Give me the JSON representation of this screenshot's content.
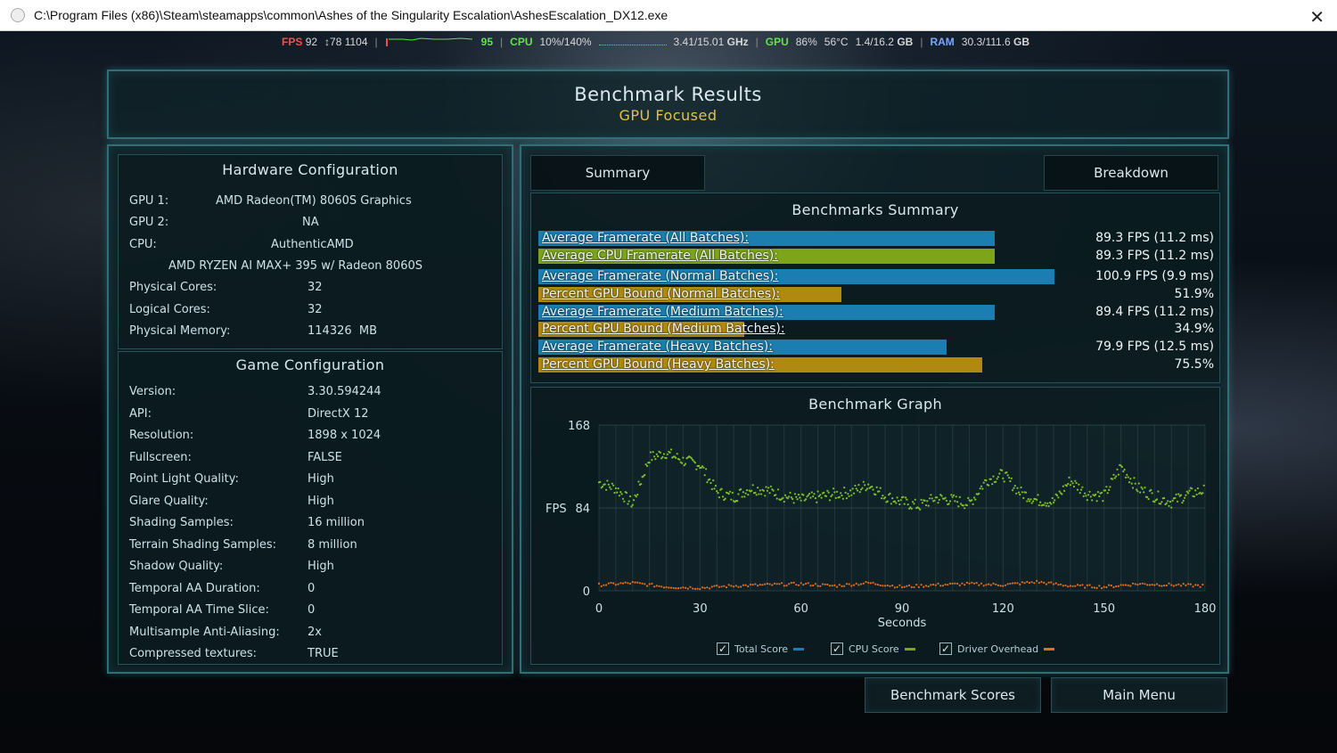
{
  "window": {
    "title": "C:\\Program Files (x86)\\Steam\\steamapps\\common\\Ashes of the Singularity Escalation\\AshesEscalation_DX12.exe",
    "close_glyph": "✕"
  },
  "overlay": {
    "fps_label": "FPS",
    "fps_value": "92",
    "frame_counts": "↕78 1104",
    "separator": "|",
    "gpu_fps_top": "95",
    "cpu_label": "CPU",
    "cpu_value": "10%/140%",
    "clock": "3.41/15.01",
    "clock_unit": "GHz",
    "gpu_label": "GPU",
    "gpu_value": "86%",
    "temp": "56°C",
    "vram": "1.4/16.2",
    "vram_unit": "GB",
    "ram_label": "RAM",
    "ram_value": "30.3/111.6",
    "ram_unit": "GB"
  },
  "header": {
    "title": "Benchmark Results",
    "subtitle": "GPU Focused"
  },
  "hardware": {
    "title": "Hardware Configuration",
    "gpu1_label": "GPU 1:",
    "gpu1_value": "AMD Radeon(TM) 8060S Graphics",
    "gpu2_label": "GPU 2:",
    "gpu2_value": "NA",
    "cpu_label": "CPU:",
    "cpu_vendor": "AuthenticAMD",
    "cpu_model": "AMD RYZEN AI MAX+ 395 w/ Radeon 8060S",
    "phys_cores_label": "Physical Cores:",
    "phys_cores_value": "32",
    "log_cores_label": "Logical Cores:",
    "log_cores_value": "32",
    "phys_mem_label": "Physical Memory:",
    "phys_mem_value": "114326  MB"
  },
  "game_config": {
    "title": "Game Configuration",
    "rows": [
      {
        "label": "Version:",
        "value": "3.30.594244"
      },
      {
        "label": "API:",
        "value": "DirectX 12"
      },
      {
        "label": "Resolution:",
        "value": "1898 x 1024"
      },
      {
        "label": "Fullscreen:",
        "value": "FALSE"
      },
      {
        "label": "Point Light Quality:",
        "value": "High"
      },
      {
        "label": "Glare Quality:",
        "value": "High"
      },
      {
        "label": "Shading Samples:",
        "value": "16 million"
      },
      {
        "label": "Terrain Shading Samples:",
        "value": "8 million"
      },
      {
        "label": "Shadow Quality:",
        "value": "High"
      },
      {
        "label": "Temporal AA Duration:",
        "value": "0"
      },
      {
        "label": "Temporal AA Time Slice:",
        "value": "0"
      },
      {
        "label": "Multisample Anti-Aliasing:",
        "value": "2x"
      },
      {
        "label": "Compressed textures:",
        "value": "TRUE"
      }
    ]
  },
  "tabs": {
    "summary": "Summary",
    "breakdown": "Breakdown"
  },
  "summary": {
    "title": "Benchmarks Summary",
    "colors": {
      "blue": "#1a7fb0",
      "green": "#7ea51a",
      "gold": "#b08a10"
    },
    "rows": [
      {
        "label": "Average Framerate (All Batches):",
        "value": "89.3 FPS (11.2 ms)",
        "fill": 0.774,
        "color": "blue"
      },
      {
        "label": "Average CPU Framerate (All Batches):",
        "value": "89.3 FPS (11.2 ms)",
        "fill": 0.774,
        "color": "green"
      },
      {
        "label": "Average Framerate (Normal Batches):",
        "value": "100.9 FPS (9.9 ms)",
        "fill": 0.874,
        "color": "blue"
      },
      {
        "label": "Percent GPU Bound (Normal Batches):",
        "value": "51.9%",
        "fill": 0.514,
        "color": "gold"
      },
      {
        "label": "Average Framerate (Medium Batches):",
        "value": "89.4 FPS (11.2 ms)",
        "fill": 0.774,
        "color": "blue"
      },
      {
        "label": "Percent GPU Bound (Medium Batches):",
        "value": "34.9%",
        "fill": 0.349,
        "color": "gold"
      },
      {
        "label": "Average Framerate (Heavy Batches):",
        "value": "79.9 FPS (12.5 ms)",
        "fill": 0.692,
        "color": "blue"
      },
      {
        "label": "Percent GPU Bound (Heavy Batches):",
        "value": "75.5%",
        "fill": 0.752,
        "color": "gold"
      }
    ]
  },
  "graph": {
    "title": "Benchmark Graph",
    "legend": [
      {
        "label": "Total Score",
        "color": "#1a7fb0",
        "checked": "✓"
      },
      {
        "label": "CPU Score",
        "color": "#7ea51a",
        "checked": "✓"
      },
      {
        "label": "Driver Overhead",
        "color": "#e07020",
        "checked": "✓"
      }
    ]
  },
  "chart_data": {
    "type": "scatter",
    "title": "Benchmark Graph",
    "xlabel": "Seconds",
    "ylabel": "FPS",
    "xlim": [
      0,
      180
    ],
    "ylim": [
      0,
      168
    ],
    "xticks": [
      0,
      30,
      60,
      90,
      120,
      150,
      180
    ],
    "yticks": [
      0,
      84,
      168
    ],
    "grid": true,
    "series": [
      {
        "name": "CPU Score",
        "color": "#7ec02a",
        "x": [
          0,
          5,
          10,
          15,
          20,
          25,
          30,
          35,
          40,
          45,
          50,
          55,
          60,
          65,
          70,
          75,
          80,
          85,
          90,
          95,
          100,
          105,
          110,
          115,
          120,
          125,
          130,
          135,
          140,
          145,
          150,
          155,
          160,
          165,
          170,
          175,
          180
        ],
        "y": [
          110,
          104,
          88,
          135,
          140,
          132,
          128,
          100,
          95,
          104,
          102,
          96,
          92,
          95,
          98,
          100,
          108,
          96,
          90,
          86,
          94,
          92,
          88,
          112,
          118,
          100,
          92,
          90,
          112,
          98,
          96,
          126,
          104,
          96,
          90,
          98,
          102
        ]
      },
      {
        "name": "Driver Overhead",
        "color": "#e07020",
        "x": [
          0,
          10,
          20,
          30,
          40,
          50,
          60,
          70,
          80,
          90,
          100,
          110,
          120,
          130,
          140,
          150,
          160,
          170,
          180
        ],
        "y": [
          6,
          8,
          4,
          3,
          5,
          6,
          7,
          5,
          8,
          4,
          6,
          7,
          6,
          9,
          5,
          4,
          7,
          6,
          5
        ]
      }
    ],
    "legend": [
      "Total Score",
      "CPU Score",
      "Driver Overhead"
    ],
    "legend_position": "bottom"
  },
  "buttons": {
    "benchmark_scores": "Benchmark Scores",
    "main_menu": "Main Menu"
  }
}
